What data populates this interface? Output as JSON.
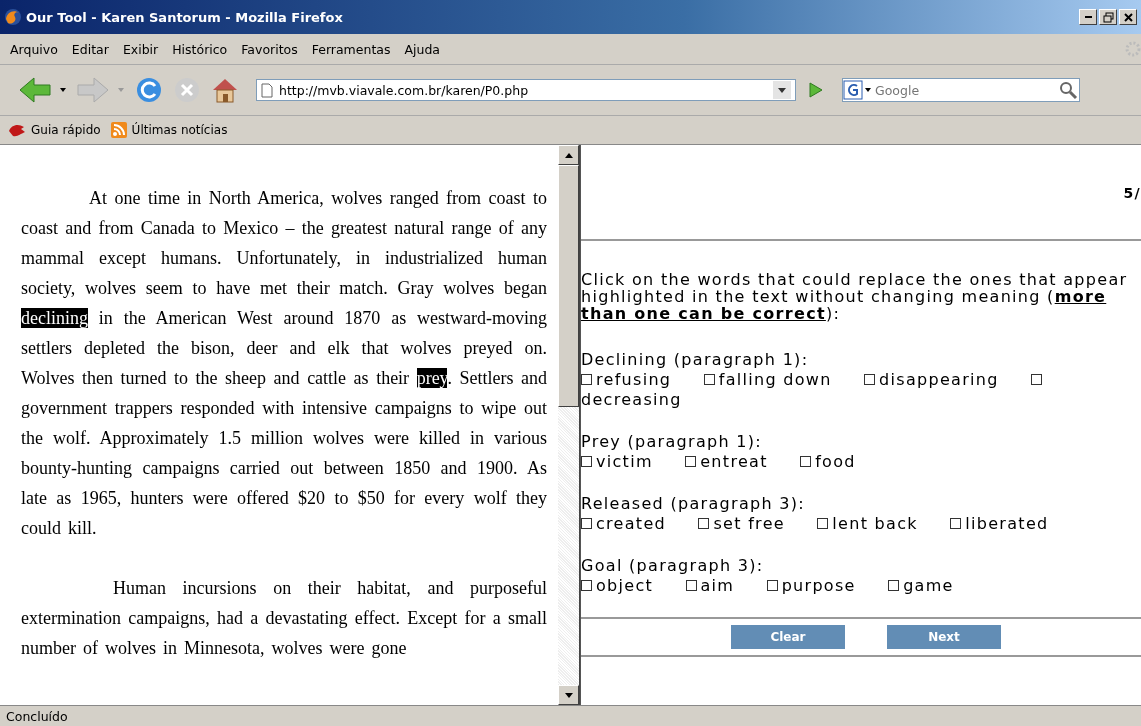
{
  "window": {
    "title": "Our Tool - Karen Santorum - Mozilla Firefox"
  },
  "menu": [
    "Arquivo",
    "Editar",
    "Exibir",
    "Histórico",
    "Favoritos",
    "Ferramentas",
    "Ajuda"
  ],
  "address_bar": {
    "value": "http://mvb.viavale.com.br/karen/P0.php"
  },
  "search": {
    "placeholder": "Google"
  },
  "bookmarks": [
    {
      "label": "Guia rápido",
      "kind": "site"
    },
    {
      "label": "Últimas notícias",
      "kind": "feed"
    }
  ],
  "reading": {
    "paragraphs": [
      [
        {
          "text": "At one time in North America, wolves ranged from coast to coast and from Canada to Mexico – the greatest natural range of any mammal except humans. Unfortunately, in industrialized human society, wolves seem to have met their match. Gray wolves began ",
          "highlighted": false
        },
        {
          "text": "declining",
          "highlighted": true
        },
        {
          "text": " in the American West around 1870 as westward-moving settlers depleted the bison, deer and elk that wolves preyed on. Wolves then turned to the sheep and cattle as their ",
          "highlighted": false
        },
        {
          "text": "prey",
          "highlighted": true
        },
        {
          "text": ". Settlers and government trappers responded with intensive campaigns to wipe out the wolf. Approximately 1.5 million wolves were killed in various bounty-hunting campaigns carried out between 1850 and 1900. As late as 1965, hunters were offered $20 to $50 for every wolf they could kill.",
          "highlighted": false
        }
      ],
      [
        {
          "text": "Human incursions on their habitat, and purposeful extermination campaigns, had a devastating effect. Except for a small number of wolves in Minnesota, wolves were gone",
          "highlighted": false
        }
      ]
    ]
  },
  "quiz": {
    "progress": "5/",
    "instruction": "Click on the words that could replace the ones that appear highlighted in the text without changing meaning (**more than one can be correct**):",
    "questions": [
      {
        "label": "Declining (paragraph 1):",
        "options": [
          {
            "text": "refusing",
            "checked": false
          },
          {
            "text": "falling down",
            "checked": false
          },
          {
            "text": "disappearing",
            "checked": false
          },
          {
            "text": "decreasing",
            "checked": false
          }
        ]
      },
      {
        "label": "Prey (paragraph 1):",
        "options": [
          {
            "text": "victim",
            "checked": false
          },
          {
            "text": "entreat",
            "checked": false
          },
          {
            "text": "food",
            "checked": false
          }
        ]
      },
      {
        "label": "Released (paragraph 3):",
        "options": [
          {
            "text": "created",
            "checked": false
          },
          {
            "text": "set free",
            "checked": false
          },
          {
            "text": "lent back",
            "checked": false
          },
          {
            "text": "liberated",
            "checked": false
          }
        ]
      },
      {
        "label": "Goal (paragraph 3):",
        "options": [
          {
            "text": "object",
            "checked": false
          },
          {
            "text": "aim",
            "checked": false
          },
          {
            "text": "purpose",
            "checked": false
          },
          {
            "text": "game",
            "checked": false
          }
        ]
      }
    ],
    "buttons": [
      "Clear",
      "Next"
    ]
  },
  "status_bar": {
    "text": "Concluído"
  }
}
